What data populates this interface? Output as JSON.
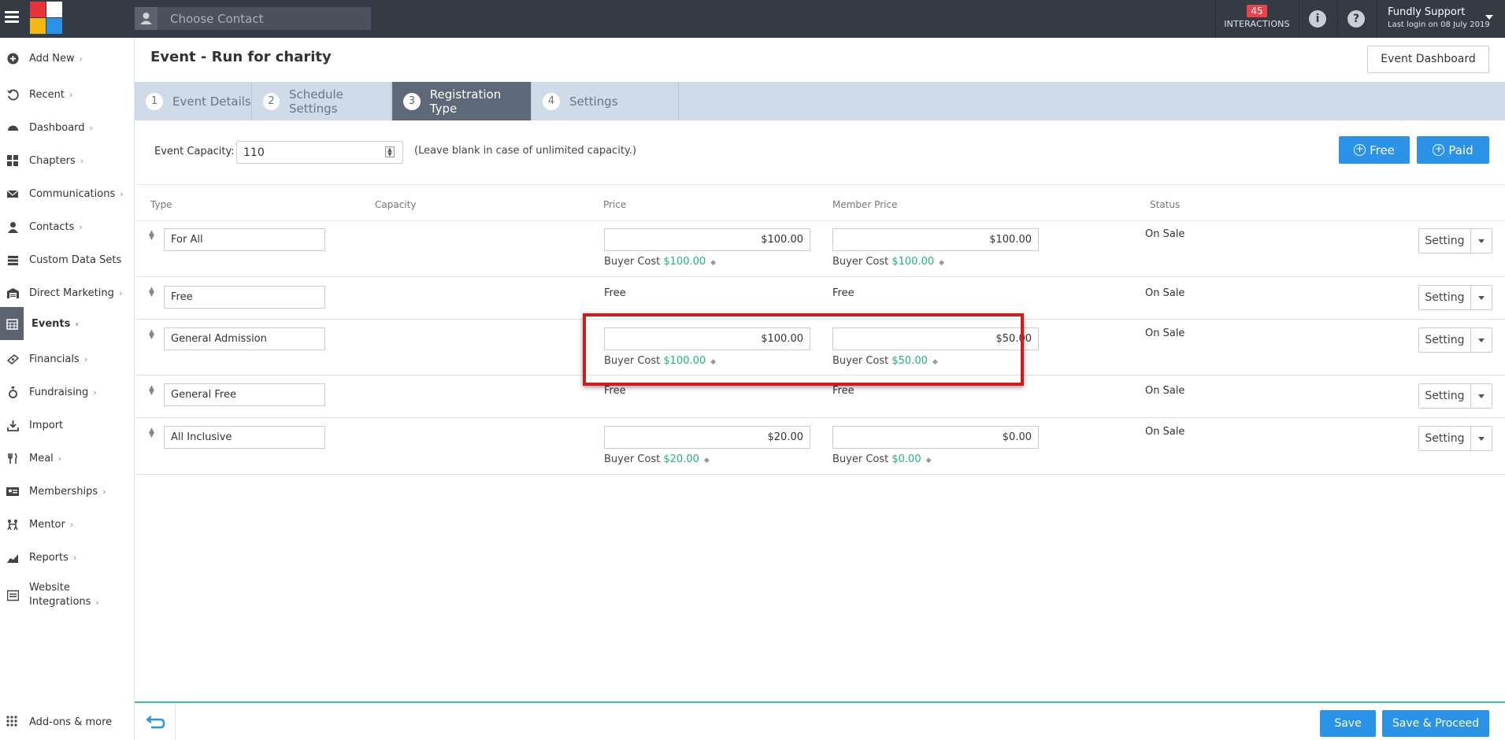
{
  "topbar": {
    "contact_placeholder": "Choose Contact",
    "interactions_count": "45",
    "interactions_label": "INTERACTIONS",
    "user_name": "Fundly Support",
    "last_login": "Last login on 08 July 2019"
  },
  "sidebar": {
    "items": [
      {
        "label": "Add New",
        "icon": "plus-circle-icon"
      },
      {
        "label": "Recent",
        "icon": "history-icon"
      },
      {
        "label": "Dashboard",
        "icon": "dashboard-icon"
      },
      {
        "label": "Chapters",
        "icon": "grid-icon"
      },
      {
        "label": "Communications",
        "icon": "envelope-icon"
      },
      {
        "label": "Contacts",
        "icon": "user-icon"
      },
      {
        "label": "Custom Data Sets",
        "icon": "layers-icon"
      },
      {
        "label": "Direct Marketing",
        "icon": "warehouse-icon"
      },
      {
        "label": "Events",
        "icon": "calendar-icon"
      },
      {
        "label": "Financials",
        "icon": "money-icon"
      },
      {
        "label": "Fundraising",
        "icon": "medal-icon"
      },
      {
        "label": "Import",
        "icon": "import-icon"
      },
      {
        "label": "Meal",
        "icon": "utensils-icon"
      },
      {
        "label": "Memberships",
        "icon": "id-card-icon"
      },
      {
        "label": "Mentor",
        "icon": "mentor-icon"
      },
      {
        "label": "Reports",
        "icon": "chart-icon"
      },
      {
        "label": "Website",
        "label2": "Integrations",
        "icon": "website-icon"
      }
    ],
    "addons": "Add-ons & more"
  },
  "main": {
    "title": "Event - Run for charity",
    "dashboard_button": "Event Dashboard",
    "tabs": [
      {
        "num": "1",
        "label": "Event Details"
      },
      {
        "num": "2",
        "label": "Schedule Settings"
      },
      {
        "num": "3",
        "label": "Registration Type"
      },
      {
        "num": "4",
        "label": "Settings"
      }
    ],
    "capacity_label": "Event Capacity:",
    "capacity_value": "110",
    "capacity_hint": "(Leave blank in case of unlimited capacity.)",
    "free_button": "Free",
    "paid_button": "Paid",
    "columns": [
      "Type",
      "Capacity",
      "Price",
      "Member Price",
      "Status"
    ],
    "buyer_cost_label": "Buyer Cost",
    "setting_label": "Setting",
    "rows": [
      {
        "type": "For All",
        "price": "$100.00",
        "price_buyer": "$100.00",
        "member": "$100.00",
        "member_buyer": "$100.00",
        "status": "On Sale"
      },
      {
        "type": "Free",
        "price": "Free",
        "member": "Free",
        "status": "On Sale"
      },
      {
        "type": "General Admission",
        "price": "$100.00",
        "price_buyer": "$100.00",
        "member": "$50.00",
        "member_buyer": "$50.00",
        "status": "On Sale"
      },
      {
        "type": "General Free",
        "price": "Free",
        "member": "Free",
        "status": "On Sale"
      },
      {
        "type": "All Inclusive",
        "price": "$20.00",
        "price_buyer": "$20.00",
        "member": "$0.00",
        "member_buyer": "$0.00",
        "status": "On Sale"
      }
    ]
  },
  "footer": {
    "save": "Save",
    "save_proceed": "Save & Proceed"
  },
  "colors": {
    "topbar": "#353b44",
    "accent_blue": "#2a93e8",
    "buyer_green": "#1bb77f",
    "highlight_red": "#d21b1b",
    "footer_line": "#2ec4a4"
  }
}
